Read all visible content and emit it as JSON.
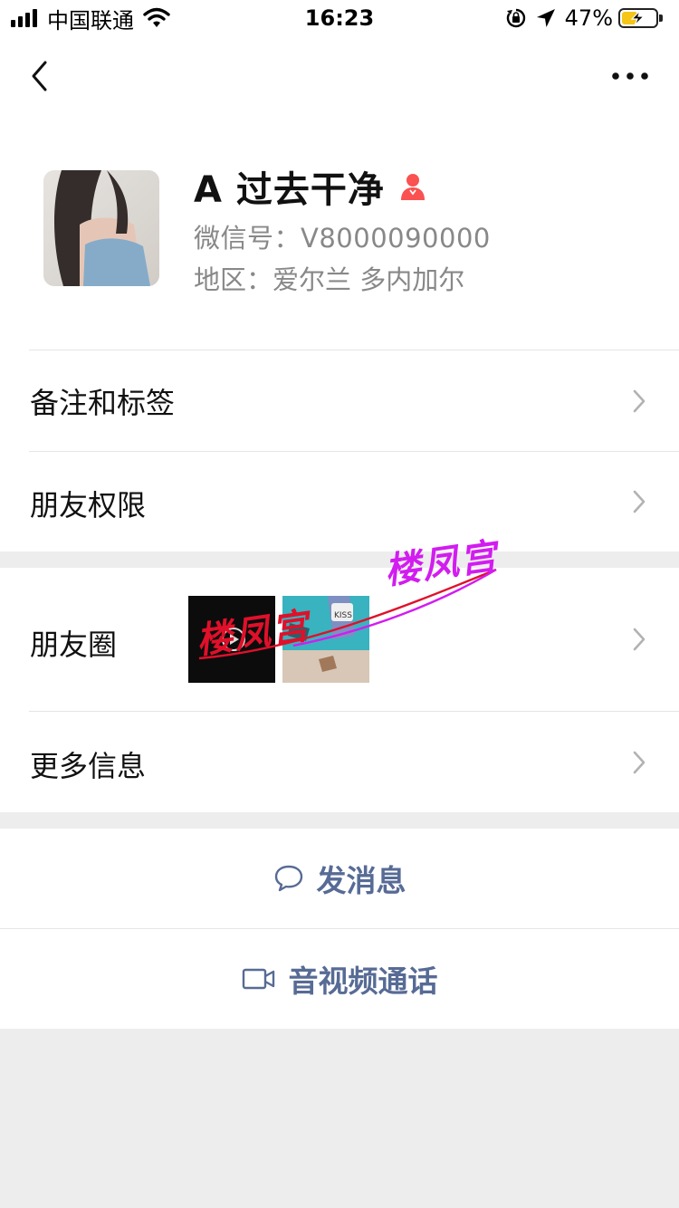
{
  "status_bar": {
    "carrier": "中国联通",
    "time": "16:23",
    "battery_percent": "47%",
    "battery_level": 0.47,
    "icons": [
      "signal-icon",
      "wifi-icon",
      "orientation-lock-icon",
      "location-arrow-icon",
      "battery-charging-icon"
    ]
  },
  "nav": {
    "back_icon": "chevron-left-icon",
    "more_icon": "more-dots-icon"
  },
  "profile": {
    "name": "A 过去干净",
    "gender_icon": "female-person-icon",
    "wechat_id": "微信号：V8000090000",
    "region": "地区：爱尔兰 多内加尔"
  },
  "cells": {
    "remarks": "备注和标签",
    "permissions": "朋友权限",
    "moments": "朋友圈",
    "more_info": "更多信息"
  },
  "watermark": {
    "text": "楼凤宫"
  },
  "actions": {
    "message": "发消息",
    "call": "音视频通话"
  },
  "colors": {
    "link_blue": "#576b95",
    "gender_pink": "#fa5151",
    "background": "#ededed",
    "watermark_red": "#e0102a",
    "watermark_magenta": "#d21cf0"
  }
}
